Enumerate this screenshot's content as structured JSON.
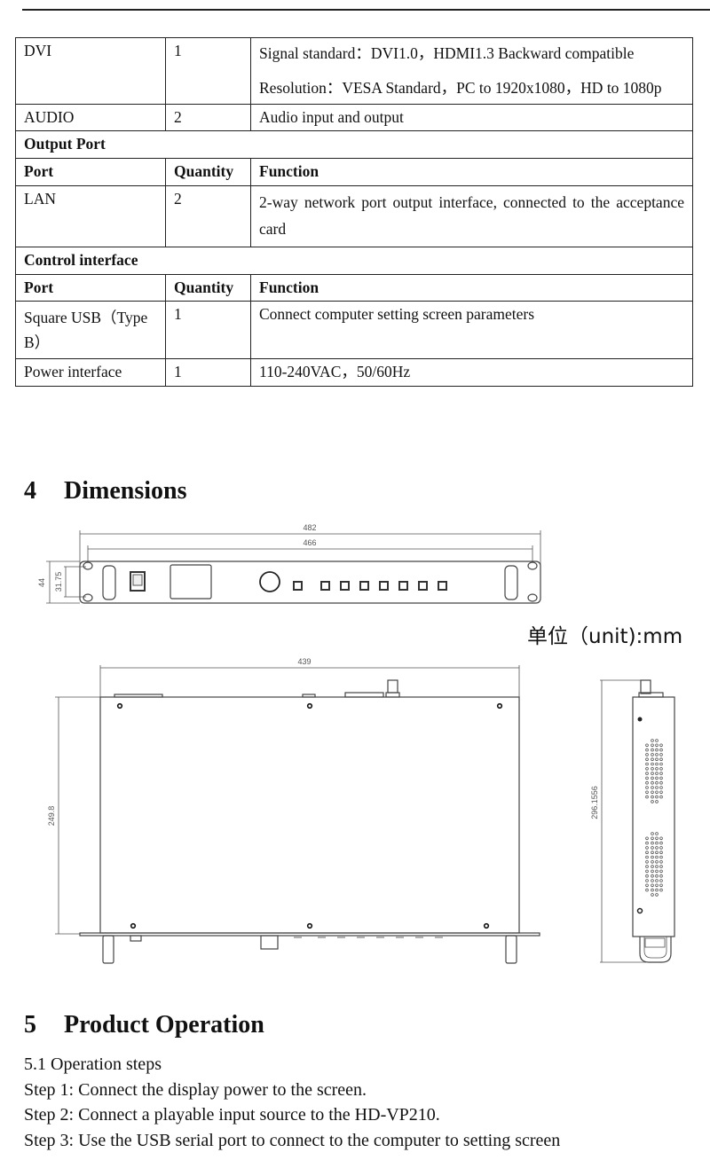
{
  "spec_table": {
    "input_rows": [
      {
        "port": "DVI",
        "quantity": "1",
        "function_lines": [
          "Signal standard：DVI1.0，HDMI1.3 Backward compatible",
          "Resolution：VESA Standard，PC to 1920x1080，HD to 1080p"
        ]
      },
      {
        "port": "AUDIO",
        "quantity": "2",
        "function": "Audio input and output"
      }
    ],
    "output_section": {
      "title": "Output Port",
      "headers": [
        "Port",
        "Quantity",
        "Function"
      ],
      "rows": [
        {
          "port": "LAN",
          "quantity": "2",
          "function": "2-way network port output interface, connected to the acceptance card"
        }
      ]
    },
    "control_section": {
      "title": "Control interface",
      "headers": [
        "Port",
        "Quantity",
        "Function"
      ],
      "rows": [
        {
          "port": "Square USB（Type B）",
          "quantity": "1",
          "function": "Connect computer setting screen parameters"
        },
        {
          "port": "Power interface",
          "quantity": "1",
          "function": "110-240VAC，50/60Hz"
        }
      ]
    }
  },
  "dimensions": {
    "number": "4",
    "title": "Dimensions",
    "unit_label": "单位（unit):mm",
    "labels": {
      "overall_width": "482",
      "mount_width": "466",
      "height": "44",
      "hole_spacing": "31.75",
      "body_width": "439",
      "body_depth": "249.8",
      "total_depth": "296.1556"
    }
  },
  "operation": {
    "number": "5",
    "title": "Product Operation",
    "subtitle": "5.1 Operation steps",
    "steps": [
      "Step 1: Connect the display power to the screen.",
      "Step 2: Connect a playable input source to the HD-VP210.",
      "Step 3: Use the USB serial port to connect to the computer to setting screen"
    ]
  }
}
